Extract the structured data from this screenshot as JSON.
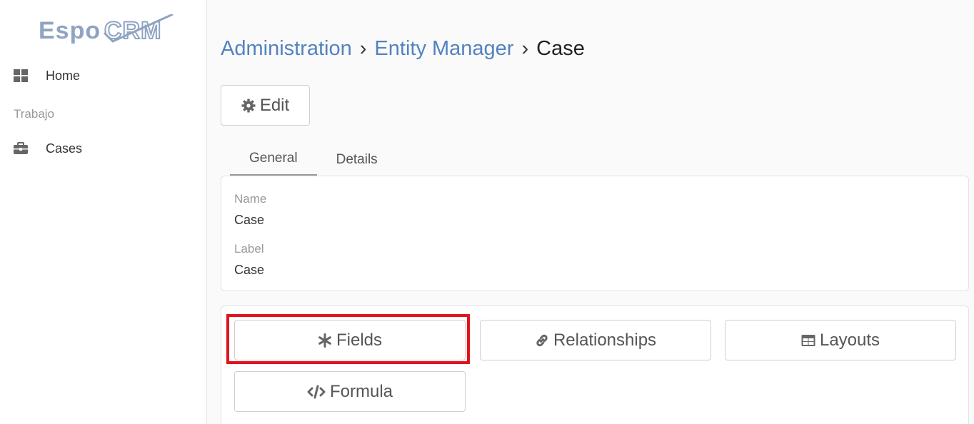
{
  "logo": {
    "text": "EspoCRM"
  },
  "sidebar": {
    "home_label": "Home",
    "group_label": "Trabajo",
    "cases_label": "Cases"
  },
  "breadcrumb": {
    "items": [
      "Administration",
      "Entity Manager",
      "Case"
    ],
    "separator": "›"
  },
  "toolbar": {
    "edit_label": "Edit"
  },
  "tabs": [
    {
      "label": "General",
      "active": true
    },
    {
      "label": "Details",
      "active": false
    }
  ],
  "info": {
    "name_label": "Name",
    "name_value": "Case",
    "label_label": "Label",
    "label_value": "Case"
  },
  "actions": {
    "fields_label": "Fields",
    "relationships_label": "Relationships",
    "layouts_label": "Layouts",
    "formula_label": "Formula"
  },
  "colors": {
    "link": "#5482c0",
    "highlight": "#e0141e",
    "logo": "#8fa3c2"
  }
}
